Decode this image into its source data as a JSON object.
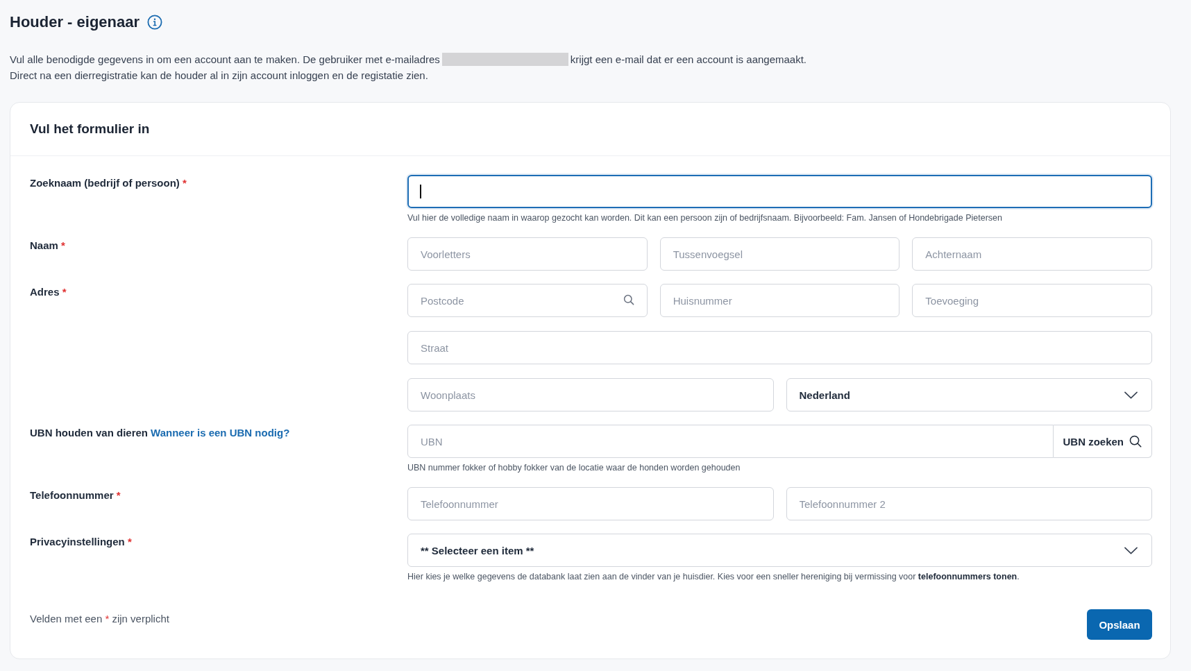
{
  "page": {
    "title": "Houder - eigenaar"
  },
  "intro": {
    "before_redaction": "Vul alle benodigde gegevens in om een account aan te maken. De gebruiker met e-mailadres",
    "redacted": true,
    "after_redaction": "krijgt een e-mail dat er een account is aangemaakt.",
    "line_2": "Direct na een dierregistratie kan de houder al in zijn account inloggen en de registatie zien."
  },
  "form": {
    "title": "Vul het formulier in",
    "rows": [
      {
        "label": "Zoeknaam (bedrijf of persoon)",
        "required_mark": "*",
        "field_rows": [
          [
            {
              "kind": "text",
              "focused": true
            }
          ]
        ],
        "hint": "Vul hier de volledige naam in waarop gezocht kan worden. Dit kan een persoon zijn of bedrijfsnaam. Bijvoorbeeld: Fam. Jansen of Hondebrigade Pietersen"
      },
      {
        "label": "Naam",
        "required_mark": "*",
        "field_rows": [
          [
            {
              "kind": "text",
              "placeholder": "Voorletters",
              "focused": false
            },
            {
              "kind": "text",
              "placeholder": "Tussenvoegsel",
              "focused": false
            },
            {
              "kind": "text",
              "placeholder": "Achternaam",
              "focused": false
            }
          ]
        ]
      },
      {
        "label": "Adres",
        "required_mark": "*",
        "field_rows": [
          [
            {
              "kind": "search",
              "placeholder": "Postcode",
              "focused": false
            },
            {
              "kind": "text",
              "placeholder": "Huisnummer",
              "focused": false
            },
            {
              "kind": "text",
              "placeholder": "Toevoeging",
              "focused": false
            }
          ],
          [
            {
              "kind": "text",
              "placeholder": "Straat",
              "focused": false
            }
          ],
          [
            {
              "kind": "text",
              "placeholder": "Woonplaats",
              "focused": false
            },
            {
              "kind": "select",
              "value": "Nederland",
              "focused": false
            }
          ]
        ]
      },
      {
        "label": "UBN houden van dieren",
        "link": "Wanneer is een UBN nodig?",
        "field_rows": [
          [
            {
              "kind": "search_button",
              "placeholder": "UBN",
              "button": "UBN zoeken",
              "focused": false
            }
          ]
        ],
        "hint": "UBN nummer fokker of hobby fokker van de locatie waar de honden worden gehouden"
      },
      {
        "label": "Telefoonnummer",
        "required_mark": "*",
        "field_rows": [
          [
            {
              "kind": "text",
              "placeholder": "Telefoonnummer",
              "focused": false
            },
            {
              "kind": "text",
              "placeholder": "Telefoonnummer 2",
              "focused": false
            }
          ]
        ]
      },
      {
        "label": "Privacyinstellingen",
        "required_mark": "*",
        "field_rows": [
          [
            {
              "kind": "select",
              "value": "** Selecteer een item **",
              "focused": false
            }
          ]
        ],
        "hint": "Hier kies je welke gegevens de databank laat zien aan de vinder van je huisdier. Kies voor een sneller hereniging bij vermissing voor **telefoonnummers tonen**."
      }
    ],
    "required_note": {
      "before": "Velden met een",
      "mark": "*",
      "after": "zijn verplicht"
    },
    "submit_button": "Opslaan"
  }
}
